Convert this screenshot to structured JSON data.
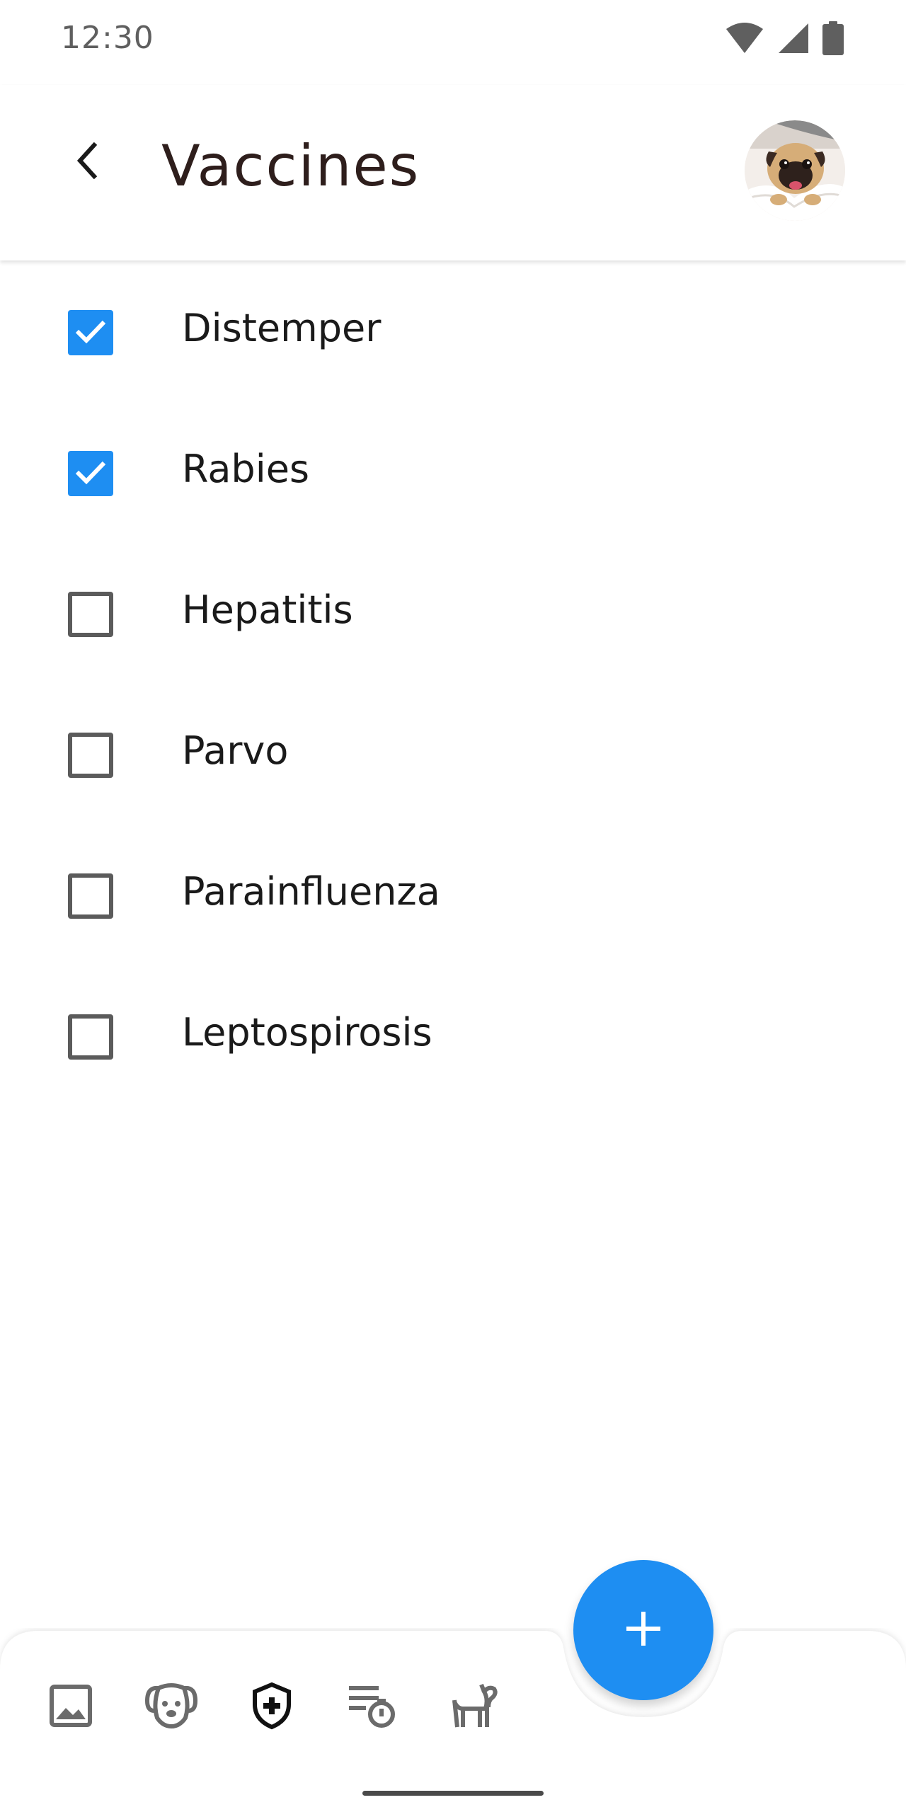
{
  "status_bar": {
    "time": "12:30"
  },
  "app_bar": {
    "title": "Vaccines",
    "back_icon": "chevron-left-icon",
    "avatar_alt": "pug"
  },
  "vaccines": [
    {
      "label": "Distemper",
      "checked": true
    },
    {
      "label": "Rabies",
      "checked": true
    },
    {
      "label": "Hepatitis",
      "checked": false
    },
    {
      "label": "Parvo",
      "checked": false
    },
    {
      "label": "Parainfluenza",
      "checked": false
    },
    {
      "label": "Leptospirosis",
      "checked": false
    }
  ],
  "bottom_nav": {
    "items": [
      {
        "icon": "gallery-icon"
      },
      {
        "icon": "dog-face-icon"
      },
      {
        "icon": "vaccine-shield-icon",
        "active": true
      },
      {
        "icon": "schedule-timer-icon"
      },
      {
        "icon": "dog-walk-icon"
      }
    ],
    "fab_icon": "plus-icon"
  },
  "colors": {
    "accent": "#1e8ef2",
    "title": "#2e1e1c",
    "text": "#1a1a1a",
    "checkbox_border": "#5b5b5b"
  }
}
